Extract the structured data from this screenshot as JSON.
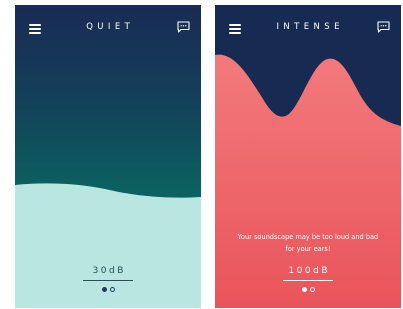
{
  "screens": [
    {
      "title": "QUIET",
      "level": "30dB",
      "pager": {
        "active_index": 0,
        "count": 2
      },
      "icons": {
        "menu": "hamburger-menu-icon",
        "chat": "chat-bubble-icon"
      },
      "colors": {
        "top": "#1a2b54",
        "mid": "#0b6260",
        "wave": "#b9e6e0"
      }
    },
    {
      "title": "INTENSE",
      "warning": "Your soundscape may be too loud and bad for your ears!",
      "level": "100dB",
      "pager": {
        "active_index": 0,
        "count": 2
      },
      "icons": {
        "menu": "hamburger-menu-icon",
        "chat": "chat-bubble-icon"
      },
      "colors": {
        "top": "#172a52",
        "wave": "#ef6a6c",
        "wave_shadow": "#a85a69"
      }
    }
  ]
}
